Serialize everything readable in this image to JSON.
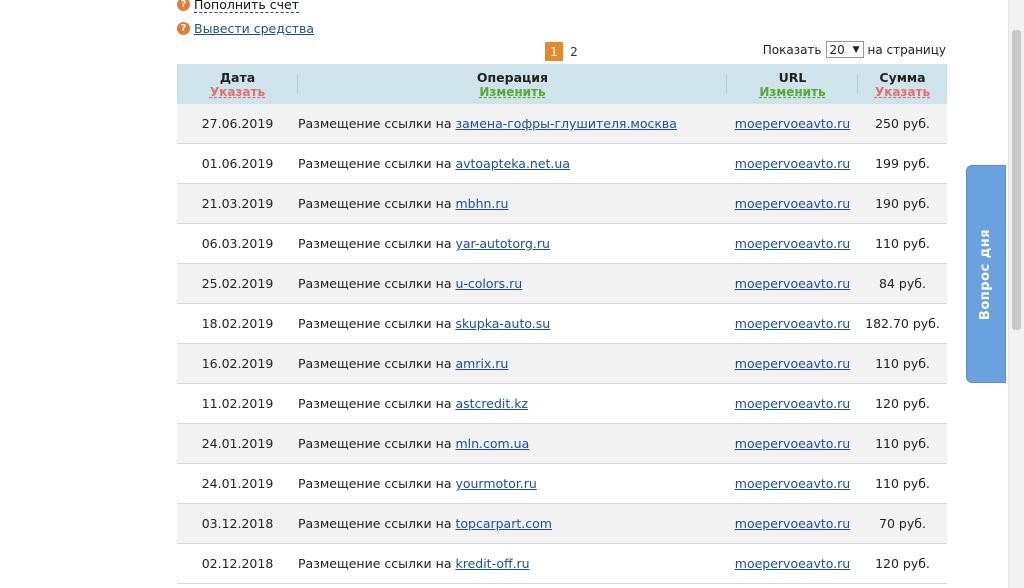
{
  "top_links": [
    {
      "label": "Пополнить счет",
      "style": "dashed"
    },
    {
      "label": "Вывести средства",
      "style": "link"
    }
  ],
  "pager": {
    "current": "1",
    "pages": [
      "2"
    ]
  },
  "per_page": {
    "prefix": "Показать",
    "value": "20",
    "suffix": "на страницу"
  },
  "table": {
    "headers": [
      {
        "title": "Дата",
        "action": "Указать",
        "action_color": "red"
      },
      {
        "title": "Операция",
        "action": "Изменить",
        "action_color": "green"
      },
      {
        "title": "URL",
        "action": "Изменить",
        "action_color": "green"
      },
      {
        "title": "Сумма",
        "action": "Указать",
        "action_color": "red"
      }
    ],
    "op_prefix": "Размещение ссылки на",
    "rows": [
      {
        "date": "27.06.2019",
        "site": "замена-гофры-глушителя.москва",
        "url": "moepervoeavto.ru",
        "sum": "250 руб."
      },
      {
        "date": "01.06.2019",
        "site": "avtoapteka.net.ua",
        "url": "moepervoeavto.ru",
        "sum": "199 руб."
      },
      {
        "date": "21.03.2019",
        "site": "mbhn.ru",
        "url": "moepervoeavto.ru",
        "sum": "190 руб."
      },
      {
        "date": "06.03.2019",
        "site": "yar-autotorg.ru",
        "url": "moepervoeavto.ru",
        "sum": "110 руб."
      },
      {
        "date": "25.02.2019",
        "site": "u-colors.ru",
        "url": "moepervoeavto.ru",
        "sum": "84 руб."
      },
      {
        "date": "18.02.2019",
        "site": "skupka-auto.su",
        "url": "moepervoeavto.ru",
        "sum": "182.70 руб."
      },
      {
        "date": "16.02.2019",
        "site": "amrix.ru",
        "url": "moepervoeavto.ru",
        "sum": "110 руб."
      },
      {
        "date": "11.02.2019",
        "site": "astcredit.kz",
        "url": "moepervoeavto.ru",
        "sum": "120 руб."
      },
      {
        "date": "24.01.2019",
        "site": "mln.com.ua",
        "url": "moepervoeavto.ru",
        "sum": "110 руб."
      },
      {
        "date": "24.01.2019",
        "site": "yourmotor.ru",
        "url": "moepervoeavto.ru",
        "sum": "110 руб."
      },
      {
        "date": "03.12.2018",
        "site": "topcarpart.com",
        "url": "moepervoeavto.ru",
        "sum": "70 руб."
      },
      {
        "date": "02.12.2018",
        "site": "kredit-off.ru",
        "url": "moepervoeavto.ru",
        "sum": "120 руб."
      }
    ]
  },
  "side_tab": {
    "label": "Вопрос дня"
  },
  "colors": {
    "accent": "#e5892f",
    "header_bg": "#cfe3ea",
    "link": "#1f4f8a",
    "side_tab": "#6aa2e0"
  }
}
